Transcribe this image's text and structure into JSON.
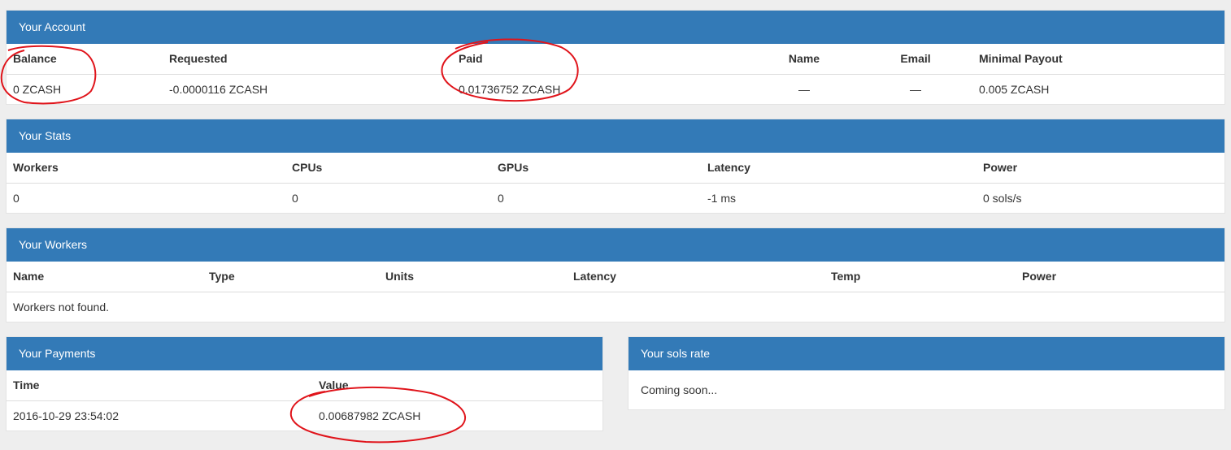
{
  "account": {
    "title": "Your Account",
    "headers": [
      "Balance",
      "Requested",
      "Paid",
      "Name",
      "Email",
      "Minimal Payout"
    ],
    "row": [
      "0 ZCASH",
      "-0.0000116 ZCASH",
      "0.01736752 ZCASH",
      "—",
      "—",
      "0.005 ZCASH"
    ]
  },
  "stats": {
    "title": "Your Stats",
    "headers": [
      "Workers",
      "CPUs",
      "GPUs",
      "Latency",
      "Power"
    ],
    "row": [
      "0",
      "0",
      "0",
      "-1 ms",
      "0 sols/s"
    ]
  },
  "workers": {
    "title": "Your Workers",
    "headers": [
      "Name",
      "Type",
      "Units",
      "Latency",
      "Temp",
      "Power"
    ],
    "empty_message": "Workers not found."
  },
  "payments": {
    "title": "Your Payments",
    "headers": [
      "Time",
      "Value"
    ],
    "row": [
      "2016-10-29 23:54:02",
      "0.00687982 ZCASH"
    ]
  },
  "sols_rate": {
    "title": "Your sols rate",
    "body": "Coming soon..."
  },
  "colors": {
    "panel_heading": "#337ab7",
    "background": "#eeeeee",
    "annotation": "#e0141b"
  }
}
